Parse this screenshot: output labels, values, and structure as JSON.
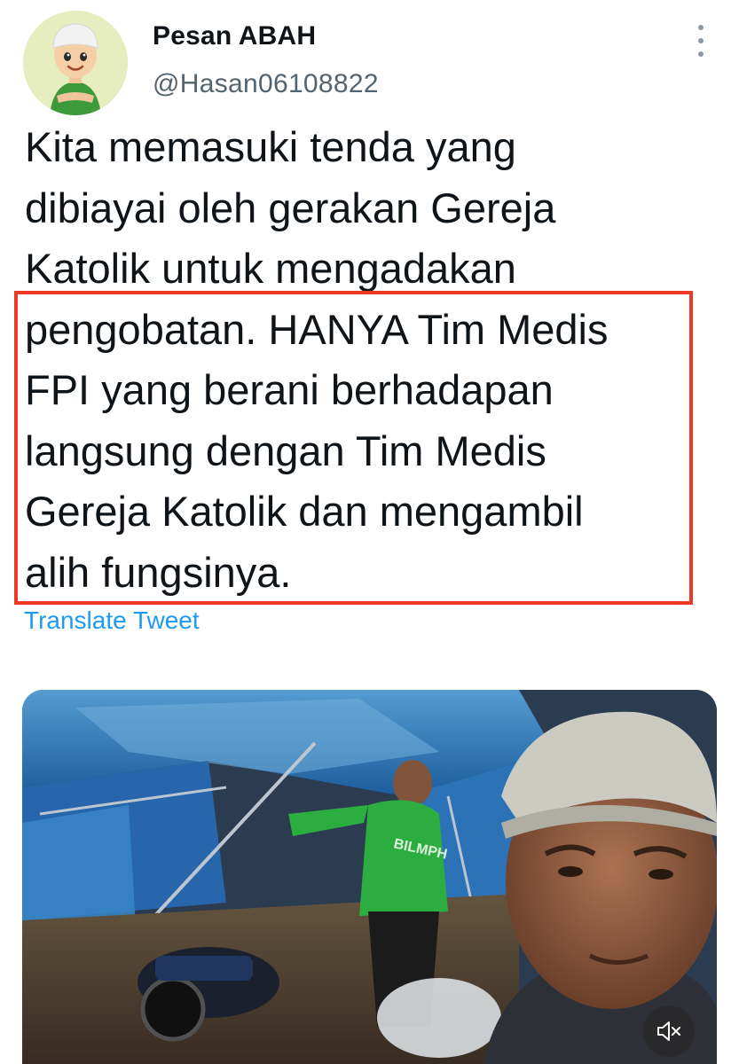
{
  "author": {
    "display_name": "Pesan ABAH",
    "handle": "@Hasan06108822",
    "avatar_icon": "cartoon-boy-avatar"
  },
  "tweet": {
    "lines": [
      "Kita memasuki tenda yang",
      "dibiayai oleh gerakan Gereja",
      "Katolik untuk mengadakan",
      "pengobatan. HANYA Tim Medis",
      "FPI yang berani berhadapan",
      "langsung dengan Tim Medis",
      "Gereja Katolik dan mengambil",
      "alih fungsinya."
    ],
    "highlight_color": "#ee3a24",
    "translate_label": "Translate Tweet"
  },
  "media": {
    "type": "video",
    "shirt_text": "BILMPH",
    "mute_icon": "speaker-muted-icon"
  },
  "colors": {
    "link": "#1d9bf0",
    "secondary_text": "#536471"
  }
}
